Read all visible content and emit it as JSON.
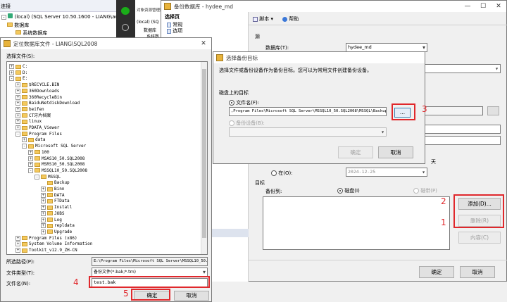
{
  "ssms": {
    "toolbar_label": "连接",
    "server_node": "(local) (SQL Server 10.50.1600 - LIANG\\admin)",
    "databases_node": "数据库",
    "system_databases_node": "系统数据库",
    "middle_title": "对象资源管理器",
    "middle_server": "(local) (SQ",
    "middle_db": "数据库",
    "middle_sys": "系统数"
  },
  "backup_dialog": {
    "title": "备份数据库 - hydee_md",
    "select_page_header": "选择页",
    "pages": [
      "常规",
      "选项"
    ],
    "toolbar_script": "脚本",
    "toolbar_help": "帮助",
    "source_section": "源",
    "database_label": "数据库(T):",
    "database_value": "hydee_md",
    "days_label": "天",
    "on_label": "在(O):",
    "on_date": "2024-12-25",
    "dest_section": "目标",
    "backup_to_label": "备份到:",
    "disk_option": "磁盘(I)",
    "tape_option": "磁带(P)",
    "add_button": "添加(D)...",
    "remove_button": "删除(R)",
    "contents_button": "内容(C)",
    "ok_button": "确定",
    "cancel_button": "取消"
  },
  "select_target_dialog": {
    "title": "选择备份目标",
    "instruction": "选择文件或备份设备作为备份目标。您可以为常用文件创建备份设备。",
    "disk_targets_label": "磁盘上的目标",
    "file_name_option": "文件名(F):",
    "file_path": ",Program Files\\Microsoft SQL Server\\MSSQL10_50.SQL2008\\MSSQL\\Backup\\",
    "browse_button": "...",
    "device_option": "备份设备(B):",
    "ok_button": "确定",
    "cancel_button": "取消"
  },
  "locate_dialog": {
    "title": "定位数据库文件 - LIANG\\SQL2008",
    "select_file_label": "选择文件(S):",
    "tree": [
      {
        "label": "C:",
        "depth": 0,
        "expander": "+"
      },
      {
        "label": "D:",
        "depth": 0,
        "expander": "+"
      },
      {
        "label": "E:",
        "depth": 0,
        "expander": "-"
      },
      {
        "label": "$RECYCLE.BIN",
        "depth": 1,
        "expander": "+"
      },
      {
        "label": "360Downloads",
        "depth": 1,
        "expander": "+"
      },
      {
        "label": "360RecycleBin",
        "depth": 1,
        "expander": "+"
      },
      {
        "label": "BaiduNetdiskDownload",
        "depth": 1,
        "expander": "+"
      },
      {
        "label": "beifen",
        "depth": 1,
        "expander": "+"
      },
      {
        "label": "CT牙片档案",
        "depth": 1,
        "expander": "+"
      },
      {
        "label": "linux",
        "depth": 1,
        "expander": "+"
      },
      {
        "label": "PDATA_Viewer",
        "depth": 1,
        "expander": "+"
      },
      {
        "label": "Program Files",
        "depth": 1,
        "expander": "-"
      },
      {
        "label": "data",
        "depth": 2,
        "expander": "+"
      },
      {
        "label": "Microsoft SQL Server",
        "depth": 2,
        "expander": "-"
      },
      {
        "label": "100",
        "depth": 3,
        "expander": "+"
      },
      {
        "label": "MSAS10_50.SQL2008",
        "depth": 3,
        "expander": "+"
      },
      {
        "label": "MSRS10_50.SQL2008",
        "depth": 3,
        "expander": "+"
      },
      {
        "label": "MSSQL10_50.SQL2008",
        "depth": 3,
        "expander": "-"
      },
      {
        "label": "MSSQL",
        "depth": 4,
        "expander": "-"
      },
      {
        "label": "Backup",
        "depth": 5,
        "expander": ""
      },
      {
        "label": "Binn",
        "depth": 5,
        "expander": "+"
      },
      {
        "label": "DATA",
        "depth": 5,
        "expander": "+"
      },
      {
        "label": "FTData",
        "depth": 5,
        "expander": "+"
      },
      {
        "label": "Install",
        "depth": 5,
        "expander": "+"
      },
      {
        "label": "JOBS",
        "depth": 5,
        "expander": "+"
      },
      {
        "label": "Log",
        "depth": 5,
        "expander": "+"
      },
      {
        "label": "repldata",
        "depth": 5,
        "expander": "+"
      },
      {
        "label": "Upgrade",
        "depth": 5,
        "expander": "+"
      },
      {
        "label": "Program Files (x86)",
        "depth": 1,
        "expander": "+"
      },
      {
        "label": "System Volume Information",
        "depth": 1,
        "expander": "+"
      },
      {
        "label": "Toolkit_v12.9_ZH-CN",
        "depth": 1,
        "expander": "+"
      }
    ],
    "selected_path_label": "所选路径(P):",
    "selected_path_value": "E:\\Program Files\\Microsoft SQL Server\\MSSQL10_50.",
    "file_type_label": "文件类型(T):",
    "file_type_value": "备份文件(*.bak;*.trn)",
    "file_name_label": "文件名(N):",
    "file_name_value": "test.bak",
    "ok_button": "确定",
    "cancel_button": "取消"
  },
  "annotations": [
    "1",
    "2",
    "3",
    "4",
    "5"
  ],
  "colors": {
    "annotation": "#e0282c",
    "folder": "#f4c95d"
  }
}
